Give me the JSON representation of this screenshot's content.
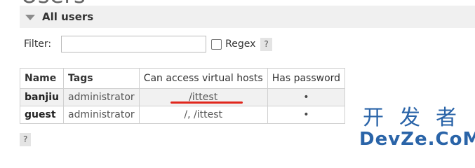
{
  "page": {
    "heading_cropped": "Users"
  },
  "section": {
    "title": "All users"
  },
  "filter": {
    "label": "Filter:",
    "value": "",
    "regex_label": "Regex",
    "regex_checked": false,
    "help_label": "?"
  },
  "table": {
    "headers": {
      "name": "Name",
      "tags": "Tags",
      "vhosts": "Can access virtual hosts",
      "password": "Has password"
    },
    "rows": [
      {
        "name": "banjiu",
        "tags": "administrator",
        "vhosts": "/ittest",
        "has_password": "•"
      },
      {
        "name": "guest",
        "tags": "administrator",
        "vhosts": "/, /ittest",
        "has_password": "•"
      }
    ]
  },
  "footer": {
    "help_label": "?"
  },
  "watermark": {
    "cn": "开发者",
    "en": "DevZe.CoM"
  },
  "colors": {
    "highlight_underline": "#e0261c",
    "watermark": "#2a64a8",
    "row_alt_bg": "#f1f1f1"
  }
}
